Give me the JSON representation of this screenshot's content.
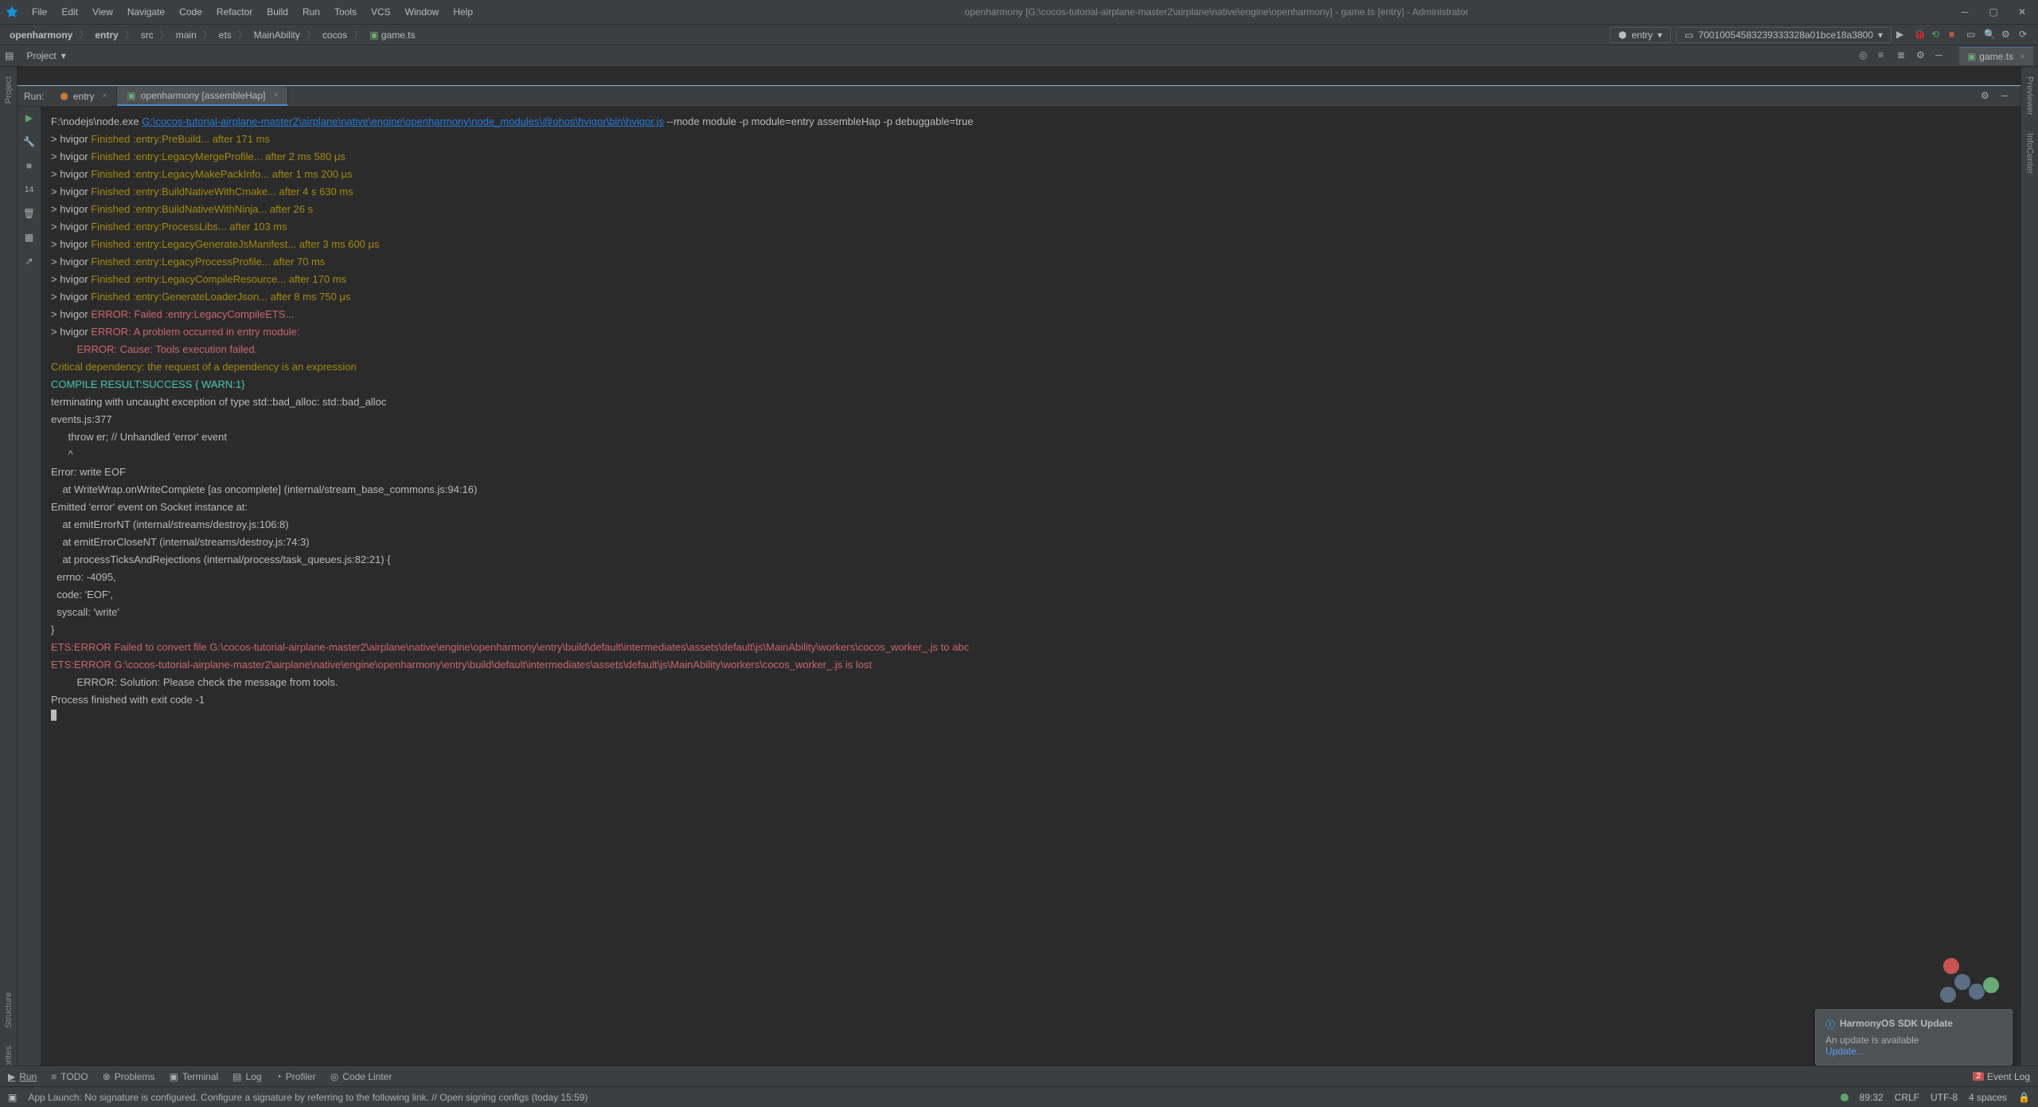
{
  "menu": [
    "File",
    "Edit",
    "View",
    "Navigate",
    "Code",
    "Refactor",
    "Build",
    "Run",
    "Tools",
    "VCS",
    "Window",
    "Help"
  ],
  "window_title": "openharmony [G:\\cocos-tutorial-airplane-master2\\airplane\\native\\engine\\openharmony] - game.ts [entry] - Administrator",
  "breadcrumbs": [
    "openharmony",
    "entry",
    "src",
    "main",
    "ets",
    "MainAbility",
    "cocos",
    "game.ts"
  ],
  "config_combo": "entry",
  "device_combo": "70010054583239333328a01bce18a3800",
  "project_label": "Project",
  "editor_tab": "game.ts",
  "run_label": "Run:",
  "run_tab_entry": "entry",
  "run_tab_assemble": "openharmony [assembleHap]",
  "left_tabs": [
    "Project",
    "Structure",
    "Favorites"
  ],
  "right_tabs": [
    "Previewer",
    "InfoCenter"
  ],
  "console_cmd_prefix": "F:\\nodejs\\node.exe ",
  "console_cmd_link": "G:\\cocos-tutorial-airplane-master2\\airplane\\native\\engine\\openharmony\\node_modules\\@ohos\\hvigor\\bin\\hvigor.js",
  "console_cmd_suffix": " --mode module -p module=entry assembleHap -p debuggable=true",
  "lines_yellow": [
    "Finished :entry:PreBuild... after 171 ms",
    "Finished :entry:LegacyMergeProfile... after 2 ms 580 μs",
    "Finished :entry:LegacyMakePackInfo... after 1 ms 200 μs",
    "Finished :entry:BuildNativeWithCmake... after 4 s 630 ms",
    "Finished :entry:BuildNativeWithNinja... after 26 s",
    "Finished :entry:ProcessLibs... after 103 ms",
    "Finished :entry:LegacyGenerateJsManifest... after 3 ms 600 μs",
    "Finished :entry:LegacyProcessProfile... after 70 ms",
    "Finished :entry:LegacyCompileResource... after 170 ms",
    "Finished :entry:GenerateLoaderJson... after 8 ms 750 μs"
  ],
  "err1": "ERROR: Failed :entry:LegacyCompileETS...",
  "err2": "ERROR: A problem occurred in entry module:",
  "err3": "ERROR: Cause: Tools execution failed.",
  "crit": "Critical dependency: the request of a dependency is an expression",
  "compile_result": "COMPILE RESULT:SUCCESS { WARN:1}",
  "stack": [
    "terminating with uncaught exception of type std::bad_alloc: std::bad_alloc",
    "events.js:377",
    "      throw er; // Unhandled 'error' event",
    "      ^",
    "",
    "Error: write EOF",
    "    at WriteWrap.onWriteComplete [as oncomplete] (internal/stream_base_commons.js:94:16)",
    "Emitted 'error' event on Socket instance at:",
    "    at emitErrorNT (internal/streams/destroy.js:106:8)",
    "    at emitErrorCloseNT (internal/streams/destroy.js:74:3)",
    "    at processTicksAndRejections (internal/process/task_queues.js:82:21) {",
    "  errno: -4095,",
    "  code: 'EOF',",
    "  syscall: 'write'",
    "}"
  ],
  "ets_err1": "ETS:ERROR Failed to convert file G:\\cocos-tutorial-airplane-master2\\airplane\\native\\engine\\openharmony\\entry\\build\\default\\intermediates\\assets\\default\\js\\MainAbility\\workers\\cocos_worker_.js to abc",
  "ets_err2": "ETS:ERROR G:\\cocos-tutorial-airplane-master2\\airplane\\native\\engine\\openharmony\\entry\\build\\default\\intermediates\\assets\\default\\js\\MainAbility\\workers\\cocos_worker_.js is lost",
  "solution": "         ERROR: Solution: Please check the message from tools.",
  "exit": "Process finished with exit code -1",
  "toast_title": "HarmonyOS SDK Update",
  "toast_body": "An update is available",
  "toast_link": "Update...",
  "bottom_items": {
    "run": "Run",
    "todo": "TODO",
    "problems": "Problems",
    "terminal": "Terminal",
    "log": "Log",
    "profiler": "Profiler",
    "linter": "Code Linter"
  },
  "event_log_label": "Event Log",
  "event_log_badge": "2",
  "status_message": "App Launch: No signature is configured. Configure a signature by referring to the following link. // Open signing configs (today 15:59)",
  "status_right": {
    "cursor": "89:32",
    "eol": "CRLF",
    "enc": "UTF-8",
    "indent": "4 spaces"
  }
}
